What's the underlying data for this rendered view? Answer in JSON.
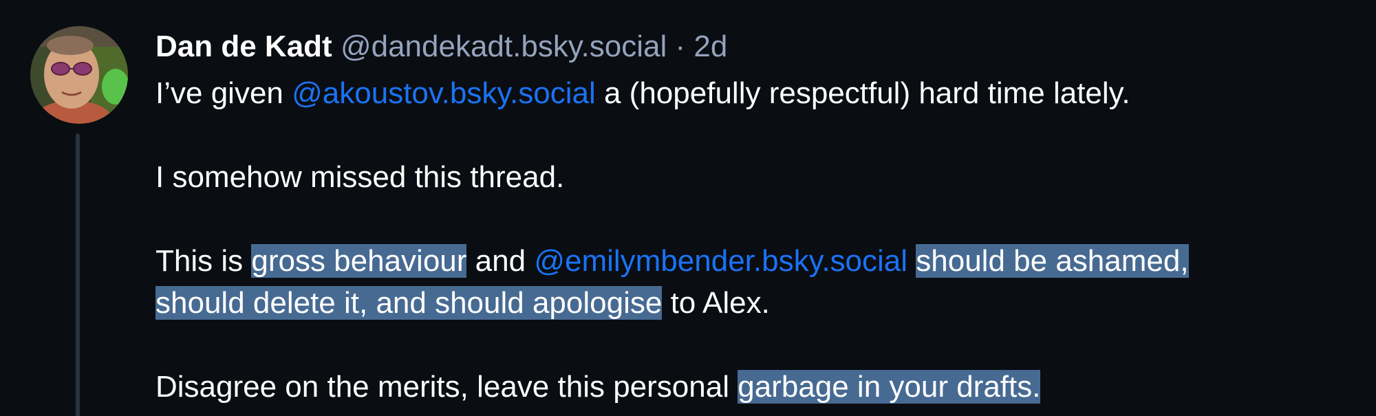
{
  "post": {
    "author_name": "Dan de Kadt",
    "author_handle": "@dandekadt.bsky.social",
    "separator": "·",
    "timestamp": "2d",
    "avatar": "author-avatar-photo",
    "paragraph1": {
      "t1": "I’ve given ",
      "mention1": "@akoustov.bsky.social",
      "t2": " a (hopefully respectful) hard time lately."
    },
    "paragraph2": {
      "t1": "I somehow missed this thread."
    },
    "paragraph3": {
      "t1": "This is ",
      "hl1": "gross behaviour",
      "t2": " and ",
      "mention1": "@emilymbender.bsky.social",
      "t3": " ",
      "hl2": "should be ashamed,",
      "hl3": "should delete it, and should apologise",
      "t4": " to Alex."
    },
    "paragraph4": {
      "t1": "Disagree on the merits, leave this personal ",
      "hl1": "garbage in your drafts."
    }
  },
  "colors": {
    "background": "#0a0d12",
    "mention": "#1a73f5",
    "highlight": "#476a92",
    "muted": "#95a3bd",
    "thread_line": "#2a3240"
  }
}
